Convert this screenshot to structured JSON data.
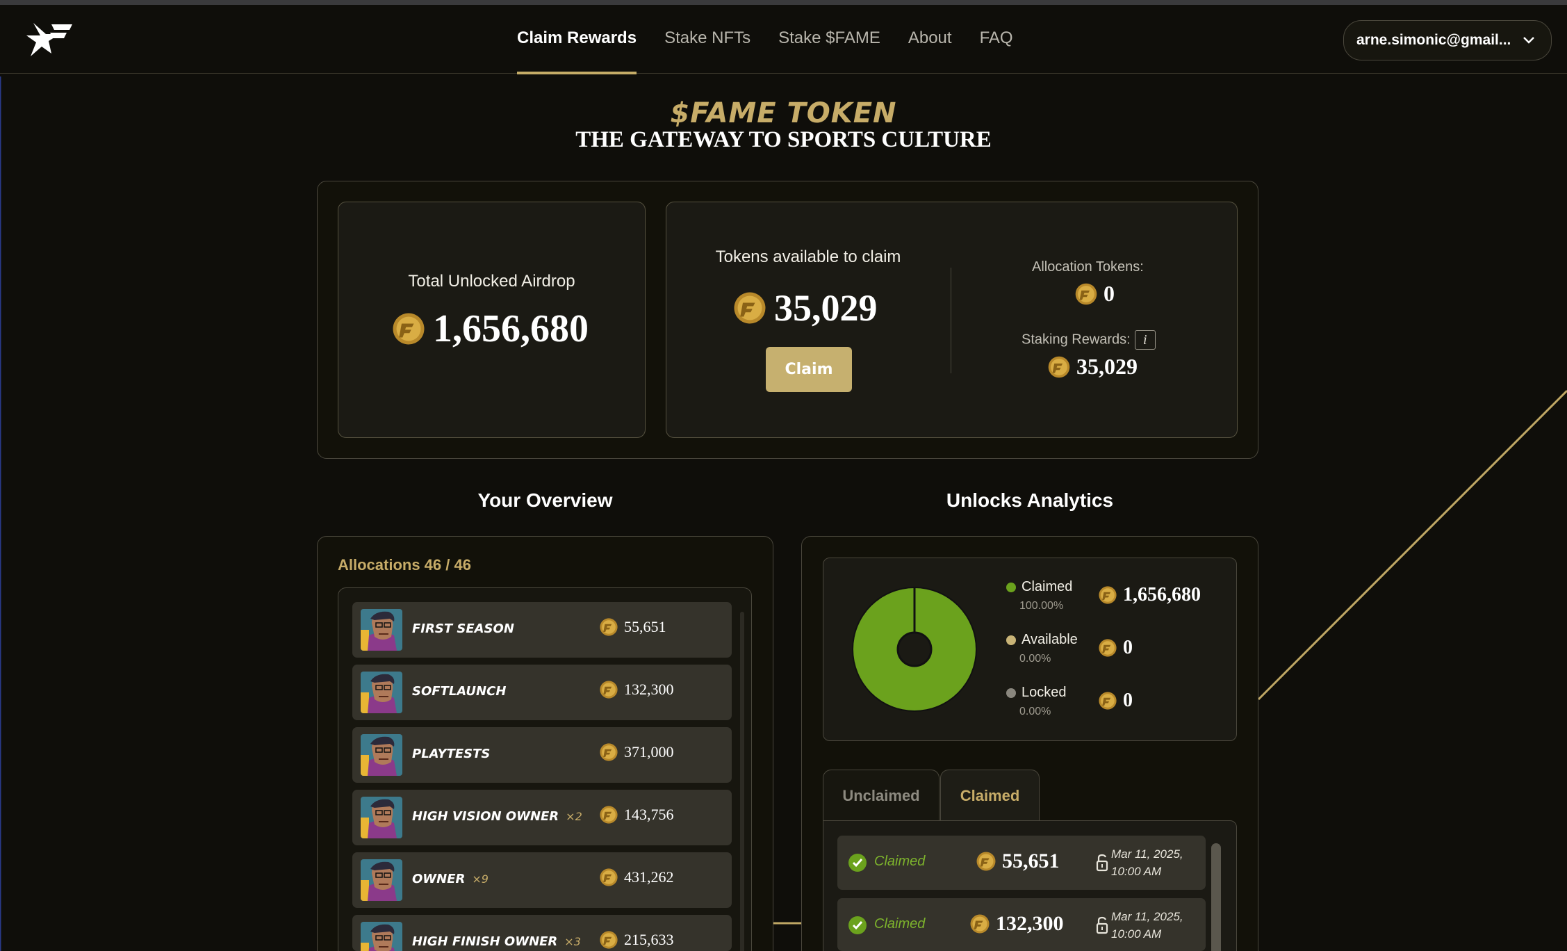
{
  "nav": {
    "items": [
      "Claim Rewards",
      "Stake NFTs",
      "Stake $FAME",
      "About",
      "FAQ"
    ],
    "active": "Claim Rewards",
    "account_email": "arne.simonic@gmail..."
  },
  "hero": {
    "title": "$FAME TOKEN",
    "subtitle": "THE GATEWAY TO SPORTS CULTURE"
  },
  "claim_panel": {
    "total_label": "Total Unlocked Airdrop",
    "total_value": "1,656,680",
    "available_label": "Tokens available to claim",
    "available_value": "35,029",
    "claim_button": "Claim",
    "allocation_label": "Allocation Tokens:",
    "allocation_value": "0",
    "staking_label": "Staking Rewards:",
    "staking_value": "35,029",
    "info_icon_text": "i"
  },
  "overview": {
    "title": "Your Overview",
    "allocations_label": "Allocations 46 / 46",
    "allocations": [
      {
        "name": "FIRST SEASON",
        "mult": "",
        "value": "55,651"
      },
      {
        "name": "SOFTLAUNCH",
        "mult": "",
        "value": "132,300"
      },
      {
        "name": "PLAYTESTS",
        "mult": "",
        "value": "371,000"
      },
      {
        "name": "HIGH VISION OWNER",
        "mult": "×2",
        "value": "143,756"
      },
      {
        "name": "OWNER",
        "mult": "×9",
        "value": "431,262"
      },
      {
        "name": "HIGH FINISH OWNER",
        "mult": "×3",
        "value": "215,633"
      }
    ]
  },
  "analytics": {
    "title": "Unlocks Analytics",
    "legend": [
      {
        "name": "Claimed",
        "pct": "100.00%",
        "value": "1,656,680",
        "color": "#6ba21d"
      },
      {
        "name": "Available",
        "pct": "0.00%",
        "value": "0",
        "color": "#c9b477"
      },
      {
        "name": "Locked",
        "pct": "0.00%",
        "value": "0",
        "color": "#8a877e"
      }
    ],
    "tabs": [
      "Unclaimed",
      "Claimed"
    ],
    "active_tab": "Claimed",
    "claims": [
      {
        "status": "Claimed",
        "value": "55,651",
        "date_line1": "Mar 11, 2025,",
        "date_line2": "10:00 AM"
      },
      {
        "status": "Claimed",
        "value": "132,300",
        "date_line1": "Mar 11, 2025,",
        "date_line2": "10:00 AM"
      }
    ]
  },
  "colors": {
    "accent_gold": "#c7ac68",
    "claimed_green": "#6ba21d",
    "background": "#0f0e0a"
  }
}
